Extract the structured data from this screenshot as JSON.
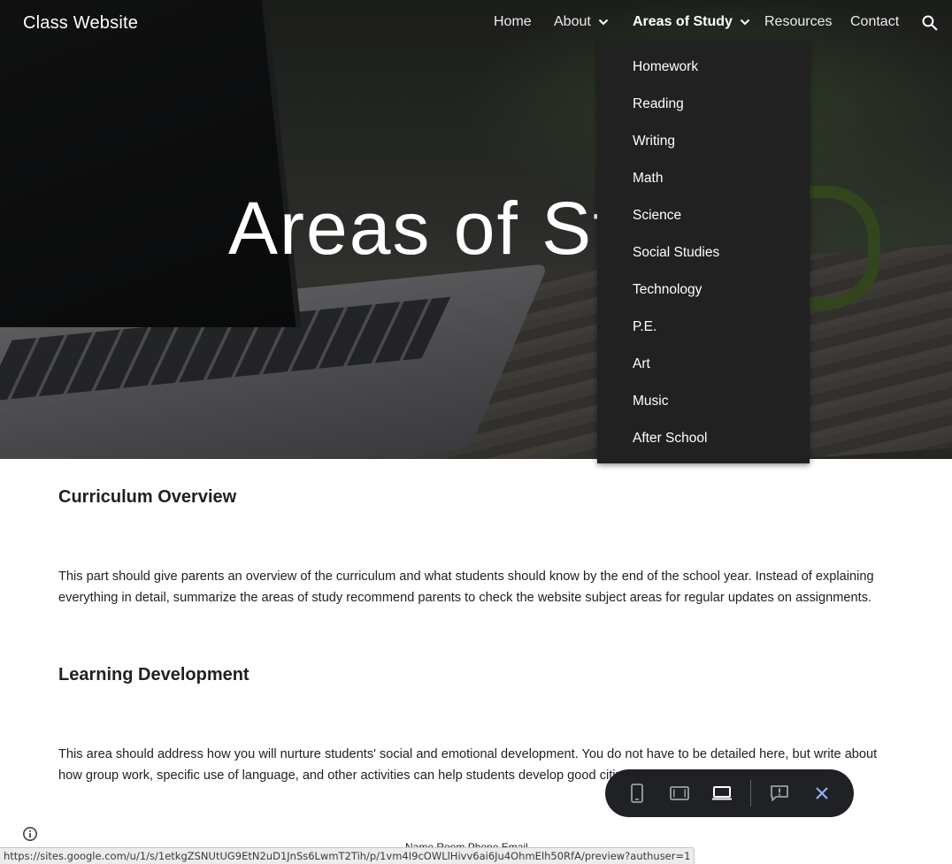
{
  "site": {
    "title": "Class Website"
  },
  "nav": {
    "items": [
      {
        "label": "Home",
        "has_dropdown": false,
        "active": false
      },
      {
        "label": "About",
        "has_dropdown": true,
        "active": false
      },
      {
        "label": "Areas of Study",
        "has_dropdown": true,
        "active": true
      },
      {
        "label": "Resources",
        "has_dropdown": false,
        "active": false
      },
      {
        "label": "Contact",
        "has_dropdown": false,
        "active": false
      }
    ],
    "search_icon": "search-icon"
  },
  "hero": {
    "title": "Areas of St"
  },
  "dropdown": {
    "items": [
      "Homework",
      "Reading",
      "Writing",
      "Math",
      "Science",
      "Social Studies",
      "Technology",
      "P.E.",
      "Art",
      "Music",
      "After School"
    ]
  },
  "sections": [
    {
      "heading": "Curriculum Overview",
      "body": "This part should give parents an overview of the curriculum and what students should know by the end of the school year. Instead of explaining everything in detail, summarize the areas of study recommend parents to check the website subject areas for regular updates on assignments."
    },
    {
      "heading": "Learning Development",
      "body": "This area should address how you will nurture students' social and emotional development. You do not have to be detailed here, but write about how group work, specific use of language, and other activities can help students develop good citizenshi"
    }
  ],
  "footer": {
    "partial_text": "Name  Room  Phone  Email"
  },
  "status_bar": {
    "url": "https://sites.google.com/u/1/s/1etkgZSNUtUG9EtN2uD1JnSs6LwmT2Tih/p/1vm4I9cOWLlHivv6ai6Ju4OhmElh50RfA/preview?authuser=1"
  },
  "preview_toolbar": {
    "buttons": [
      "phone-icon",
      "tablet-icon",
      "laptop-icon",
      "feedback-icon",
      "close-icon"
    ],
    "selected": "laptop-icon",
    "colors": {
      "background": "#202124",
      "icon": "#9aa0a6",
      "selected": "#ffffff",
      "close": "#8ab4f8"
    }
  },
  "colors": {
    "dropdown_bg": "#212121",
    "text": "#212121"
  }
}
